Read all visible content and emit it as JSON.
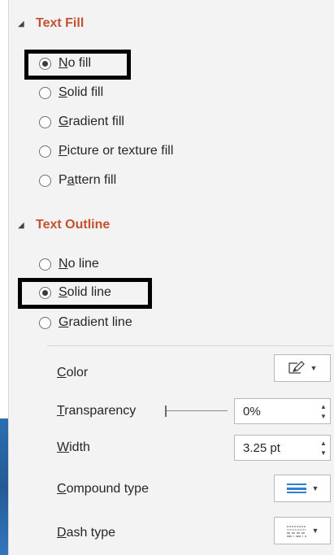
{
  "text_fill": {
    "header": "Text Fill",
    "options": [
      {
        "accel": "N",
        "rest": "o fill",
        "checked": true
      },
      {
        "accel": "S",
        "rest": "olid fill",
        "checked": false
      },
      {
        "accel": "G",
        "rest": "radient fill",
        "checked": false
      },
      {
        "accel": "P",
        "rest": "icture or texture fill",
        "checked": false
      },
      {
        "pre": "P",
        "accel": "a",
        "rest": "ttern fill",
        "checked": false
      }
    ]
  },
  "text_outline": {
    "header": "Text Outline",
    "options": [
      {
        "accel": "N",
        "rest": "o line",
        "checked": false
      },
      {
        "accel": "S",
        "rest": "olid line",
        "checked": true
      },
      {
        "accel": "G",
        "rest": "radient line",
        "checked": false
      }
    ]
  },
  "properties": {
    "color": {
      "accel": "C",
      "rest": "olor"
    },
    "transparency": {
      "accel": "T",
      "rest": "ransparency",
      "value": "0%"
    },
    "width": {
      "accel": "W",
      "rest": "idth",
      "value": "3.25 pt"
    },
    "compound_type": {
      "accel": "C",
      "rest": "ompound type"
    },
    "dash_type": {
      "accel": "D",
      "rest": "ash type"
    }
  },
  "colors": {
    "accent": "#c4512e",
    "highlight_box": "#000000",
    "compound_icon": "#2f7fd4"
  }
}
